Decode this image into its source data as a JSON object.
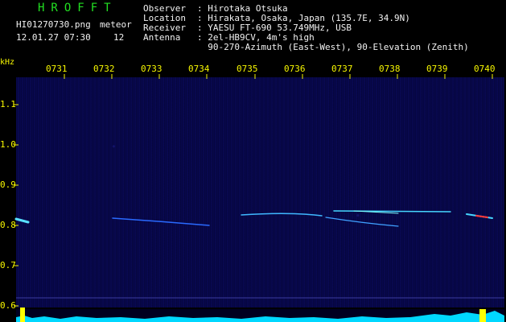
{
  "header": {
    "app_title": "HROFFT",
    "filename": "HI01270730.png",
    "datetime": "12.01.27 07:30",
    "meteor_label": "meteor",
    "meteor_count": "12",
    "info": [
      {
        "label": "Observer",
        "value": ": Hirotaka Otsuka"
      },
      {
        "label": "Location",
        "value": ": Hirakata, Osaka, Japan (135.7E, 34.9N)"
      },
      {
        "label": "Receiver",
        "value": ": YAESU FT-690 53.749MHz, USB"
      },
      {
        "label": "Antenna",
        "value": ": 2el-HB9CV, 4m's high"
      },
      {
        "label": "",
        "value": "  90-270-Azimuth (East-West), 90-Elevation (Zenith)"
      }
    ]
  },
  "axes": {
    "freq_unit": "kHz",
    "time_labels": [
      "0731",
      "0732",
      "0733",
      "0734",
      "0735",
      "0736",
      "0737",
      "0738",
      "0739",
      "0740"
    ],
    "freq_labels": [
      "1.1",
      "1.0",
      "0.9",
      "0.8",
      "0.7",
      "0.6"
    ]
  },
  "colors": {
    "background": "#000000",
    "plot_background": "#07074a",
    "title_green": "#22e022",
    "label_white": "#f2f2f2",
    "tick_yellow": "#f6f600",
    "signal_cyan": "#33ddff",
    "signal_peak": "#ff3333",
    "spectrum_bar": "#00d8ff",
    "spectrum_peak": "#ffff00"
  }
}
